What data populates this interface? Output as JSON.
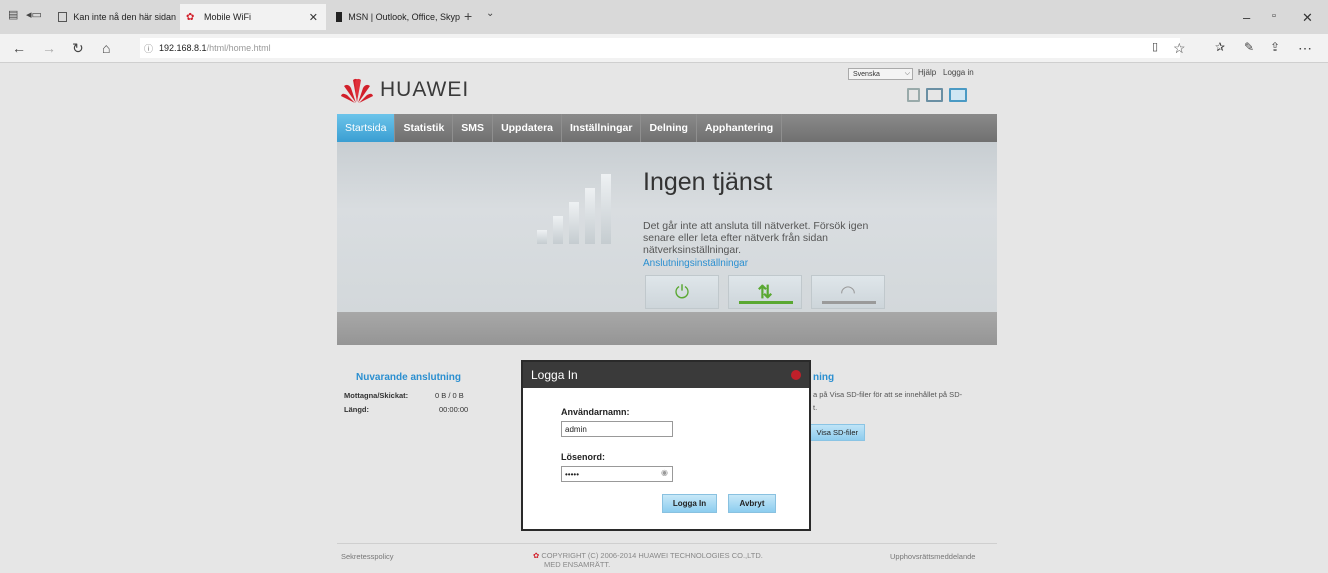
{
  "browser": {
    "tabs": [
      {
        "label": "Kan inte nå den här sidan"
      },
      {
        "label": "Mobile WiFi"
      },
      {
        "label": "MSN | Outlook, Office, Skyp"
      }
    ],
    "address": {
      "host": "192.168.8.1",
      "path": "/html/home.html"
    }
  },
  "header": {
    "language": "Svenska",
    "help": "Hjälp",
    "login": "Logga in",
    "brand": "HUAWEI"
  },
  "menu": [
    "Startsida",
    "Statistik",
    "SMS",
    "Uppdatera",
    "Inställningar",
    "Delning",
    "Apphantering"
  ],
  "hero": {
    "status": "Ingen tjänst",
    "message": "Det går inte att ansluta till nätverket. Försök igen senare eller leta efter nätverk från sidan nätverksinställningar.",
    "link": "Anslutningsinställningar",
    "colors": {
      "accent": "#2b8fd0",
      "underline_green": "#5aa832",
      "underline_grey": "#9a9a9a"
    }
  },
  "connection": {
    "title": "Nuvarande anslutning",
    "rows": [
      {
        "key": "Mottagna/Skickat:",
        "value": "0 B / 0 B"
      },
      {
        "key": "Längd:",
        "value": "00:00:00"
      }
    ]
  },
  "sd": {
    "title_fragment": "ning",
    "text_line1": "a på Visa SD-filer för att se innehållet på SD-",
    "text_line2": "t.",
    "button": "Visa SD-filer"
  },
  "footer": {
    "privacy": "Sekretesspolicy",
    "copyright_line1": "COPYRIGHT (C) 2006-2014 HUAWEI TECHNOLOGIES CO.,LTD.",
    "copyright_line2": "MED ENSAMRÄTT.",
    "notice": "Upphovsrättsmeddelande"
  },
  "login_modal": {
    "title": "Logga In",
    "username_label": "Användarnamn:",
    "username_value": "admin",
    "password_label": "Lösenord:",
    "password_value": "•••••",
    "submit": "Logga In",
    "cancel": "Avbryt"
  }
}
